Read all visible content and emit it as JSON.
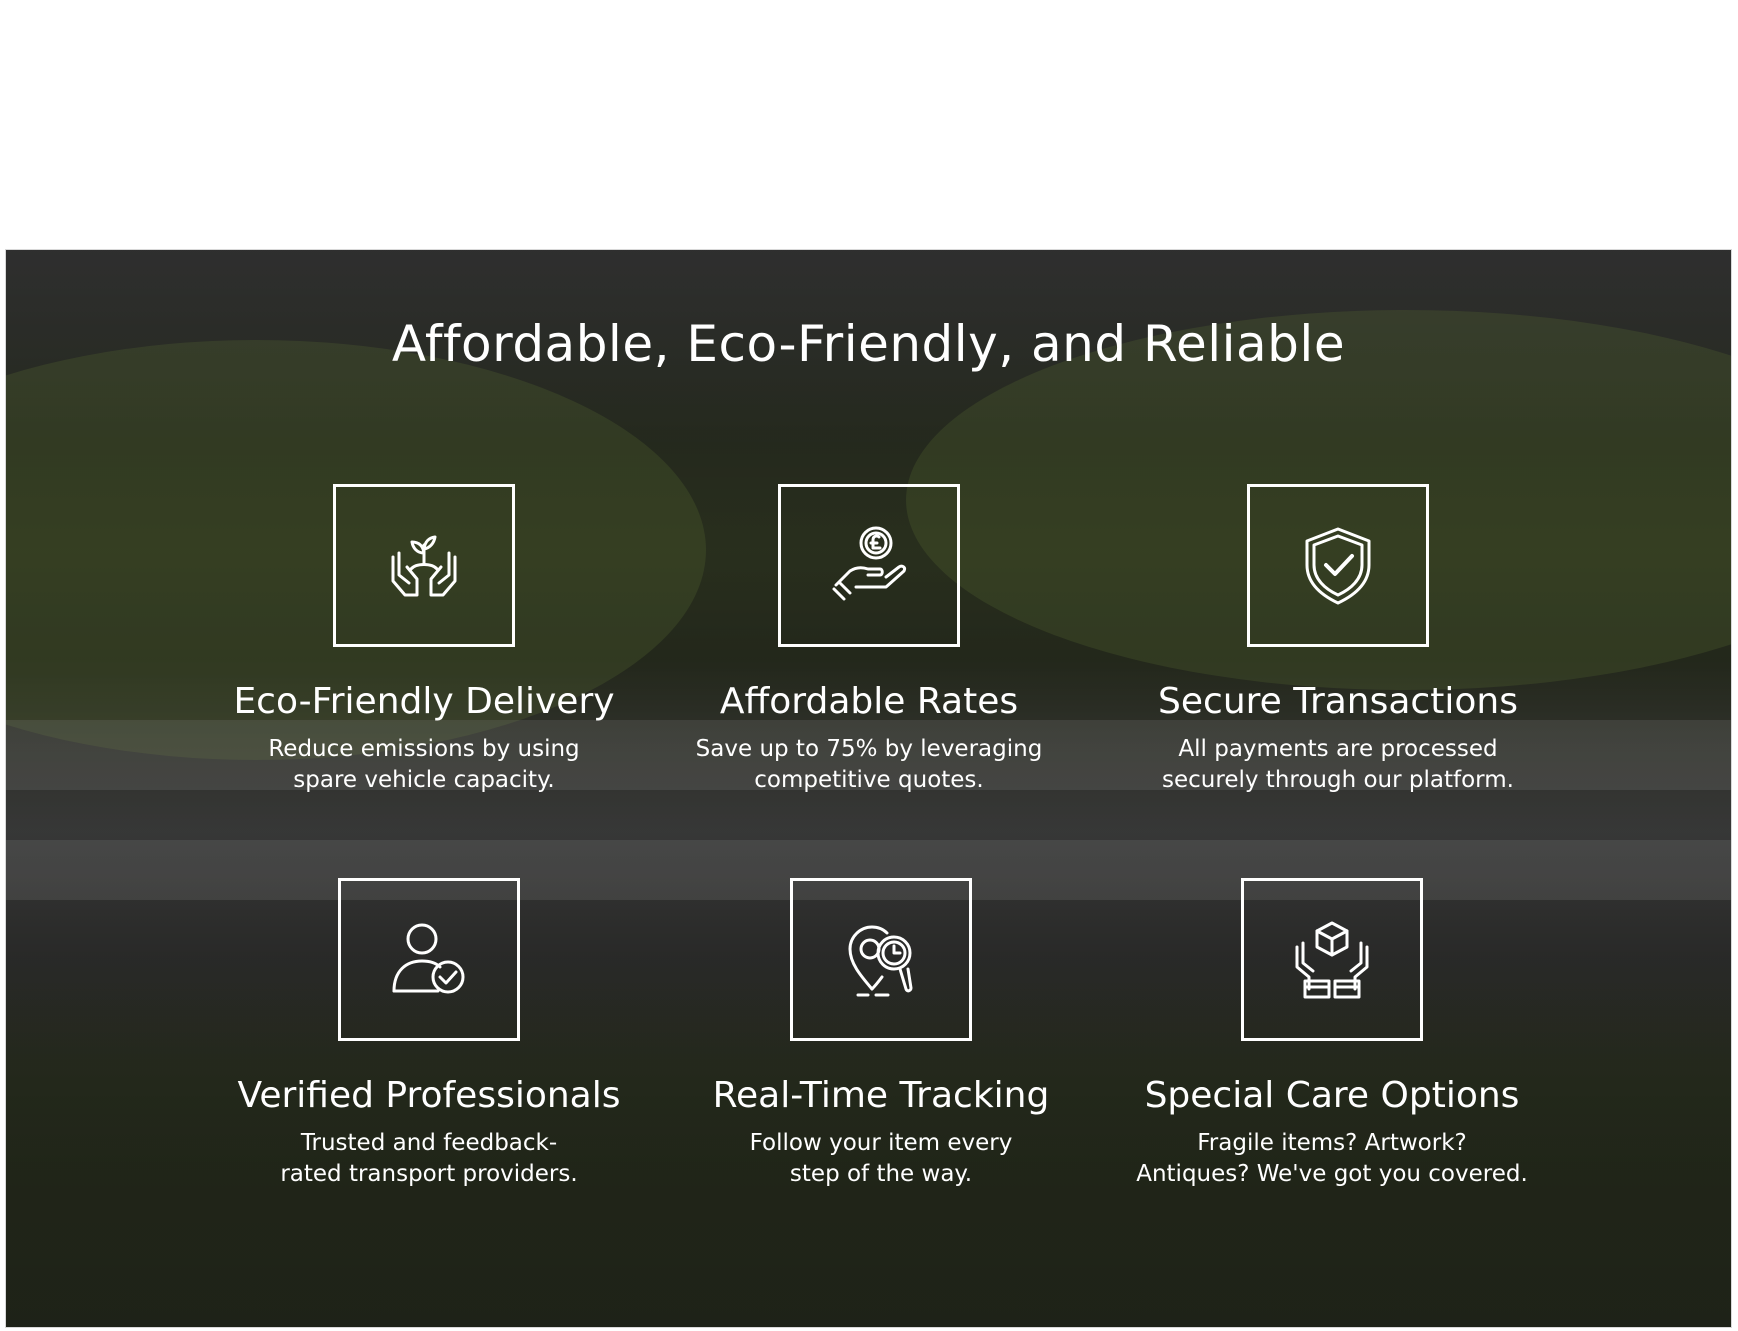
{
  "section": {
    "headline": "Affordable, Eco-Friendly, and Reliable"
  },
  "features": [
    {
      "icon": "hands-plant-icon",
      "title": "Eco-Friendly Delivery",
      "desc_line1": "Reduce emissions by using",
      "desc_line2": "spare vehicle capacity."
    },
    {
      "icon": "hand-coin-icon",
      "title": "Affordable Rates",
      "desc_line1": "Save up to 75% by leveraging",
      "desc_line2": "competitive quotes."
    },
    {
      "icon": "shield-check-icon",
      "title": "Secure Transactions",
      "desc_line1": "All payments are processed",
      "desc_line2": "securely through our platform."
    },
    {
      "icon": "user-check-icon",
      "title": "Verified Professionals",
      "desc_line1": "Trusted and feedback-",
      "desc_line2": "rated transport providers."
    },
    {
      "icon": "location-tracking-icon",
      "title": "Real-Time Tracking",
      "desc_line1": "Follow your item every",
      "desc_line2": "step of the way."
    },
    {
      "icon": "hands-box-icon",
      "title": "Special Care Options",
      "desc_line1": "Fragile items? Artwork?",
      "desc_line2": "Antiques? We've got you covered."
    }
  ],
  "colors": {
    "text": "#ffffff",
    "overlay": "#141414"
  }
}
